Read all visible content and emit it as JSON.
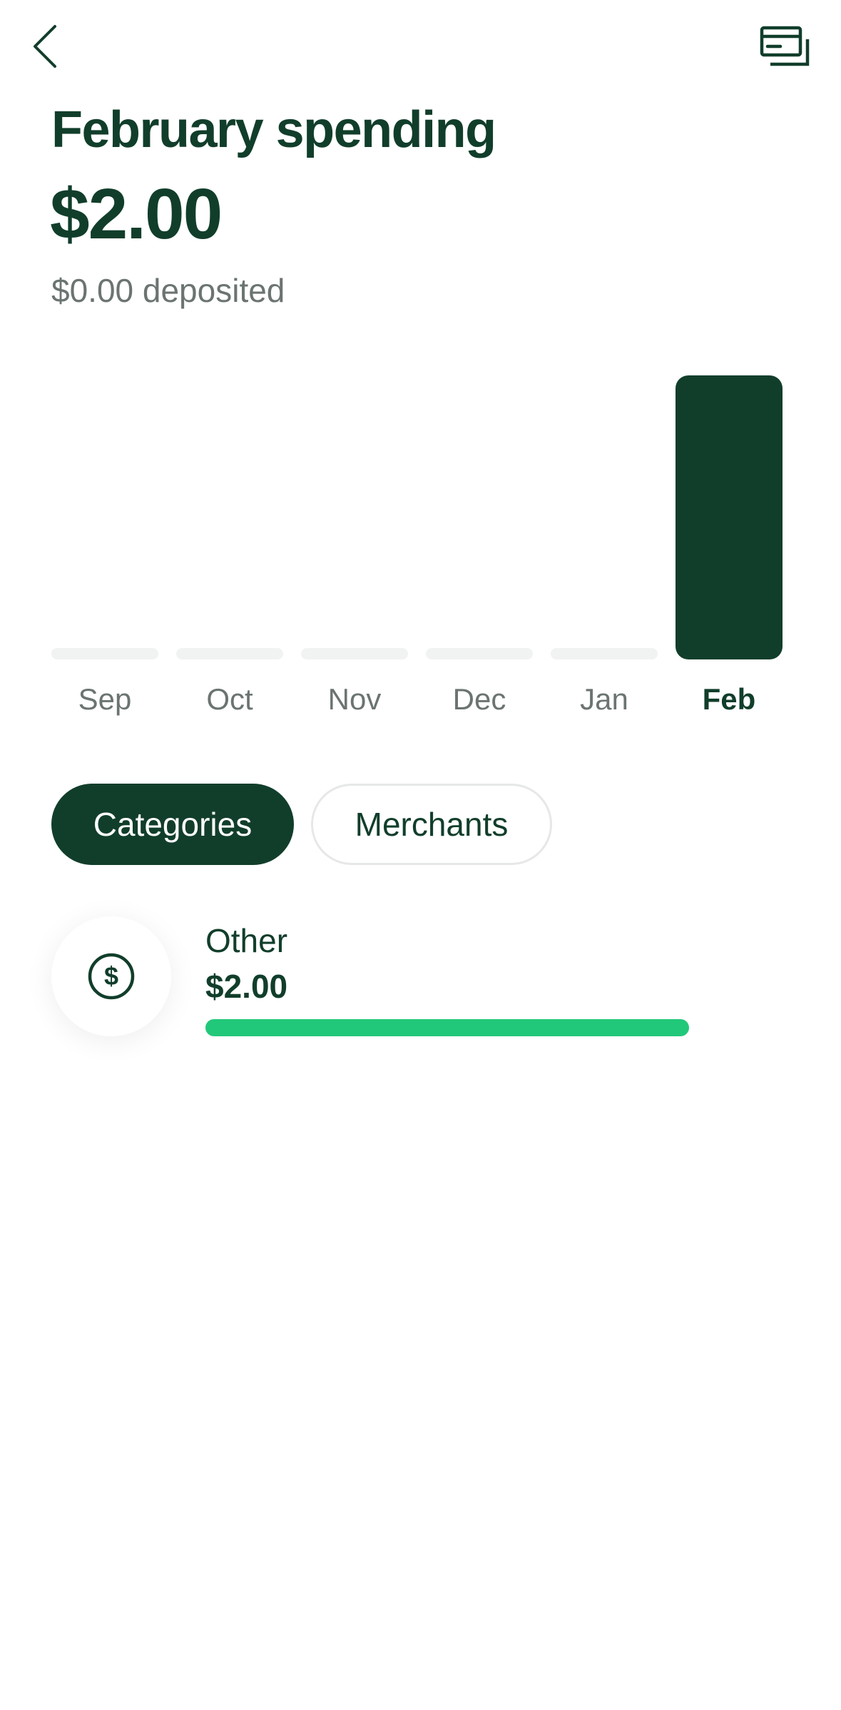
{
  "header": {
    "back_icon": "chevron-left-icon",
    "cards_icon": "cards-icon"
  },
  "summary": {
    "title": "February spending",
    "total": "$2.00",
    "deposited": "$0.00 deposited"
  },
  "chart_data": {
    "type": "bar",
    "categories": [
      "Sep",
      "Oct",
      "Nov",
      "Dec",
      "Jan",
      "Feb"
    ],
    "values": [
      0,
      0,
      0,
      0,
      0,
      2
    ],
    "selected": "Feb",
    "colors": {
      "selected": "#113e2b",
      "empty": "#f1f2f2",
      "label": "#6b7471",
      "label_selected": "#113e2b"
    }
  },
  "tabs": [
    {
      "label": "Categories",
      "active": true
    },
    {
      "label": "Merchants",
      "active": false
    }
  ],
  "categories_list": [
    {
      "name": "Other",
      "amount": "$2.00",
      "share": 1.0,
      "icon": "dollar-circle-icon"
    }
  ],
  "colors": {
    "brand_dark": "#113e2b",
    "accent_green": "#22c87a",
    "muted_text": "#6b7471"
  }
}
